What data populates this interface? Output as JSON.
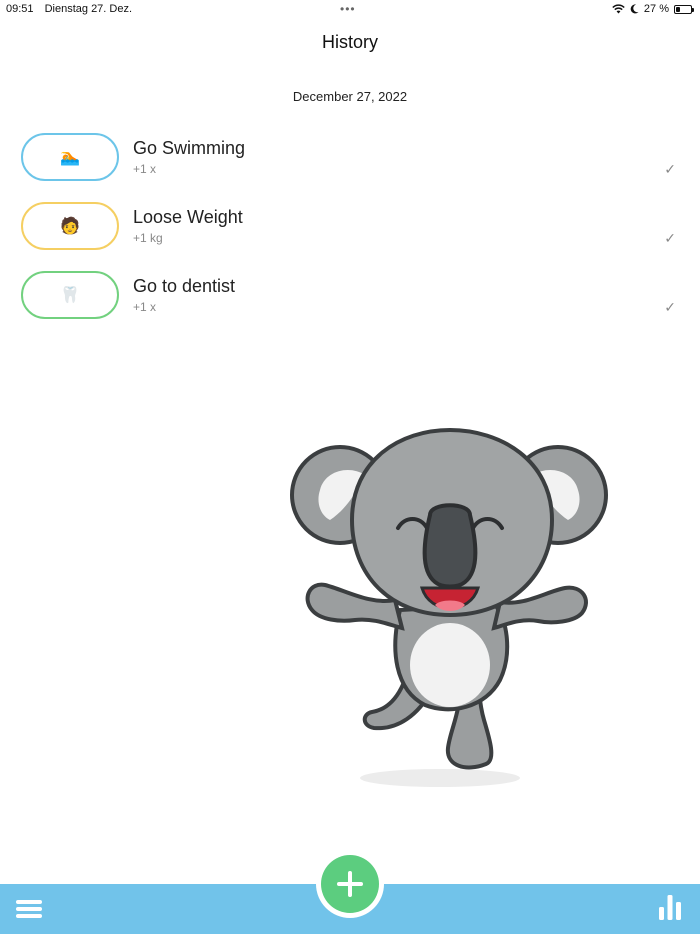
{
  "status_bar": {
    "time": "09:51",
    "date": "Dienstag 27. Dez.",
    "battery_text": "27 %",
    "battery_level": 0.27,
    "icons": [
      "wifi-icon",
      "moon-icon",
      "battery-icon"
    ]
  },
  "header": {
    "title": "History"
  },
  "history": {
    "date": "December 27, 2022",
    "items": [
      {
        "title": "Go Swimming",
        "subtitle": "+1 x",
        "emoji": "🏊",
        "color": "#6cc5e9",
        "check": "✓"
      },
      {
        "title": "Loose Weight",
        "subtitle": "+1 kg",
        "emoji": "🧑",
        "color": "#f5cf62",
        "check": "✓"
      },
      {
        "title": "Go to dentist",
        "subtitle": "+1 x",
        "emoji": "🦷",
        "color": "#72d17f",
        "check": "✓"
      }
    ]
  },
  "mascot": {
    "name": "koala-mascot"
  },
  "bottom_bar": {
    "color": "#71c3ea",
    "add_button_color": "#5ccd7f",
    "icons": [
      "menu-icon",
      "add-icon",
      "stats-icon"
    ]
  }
}
